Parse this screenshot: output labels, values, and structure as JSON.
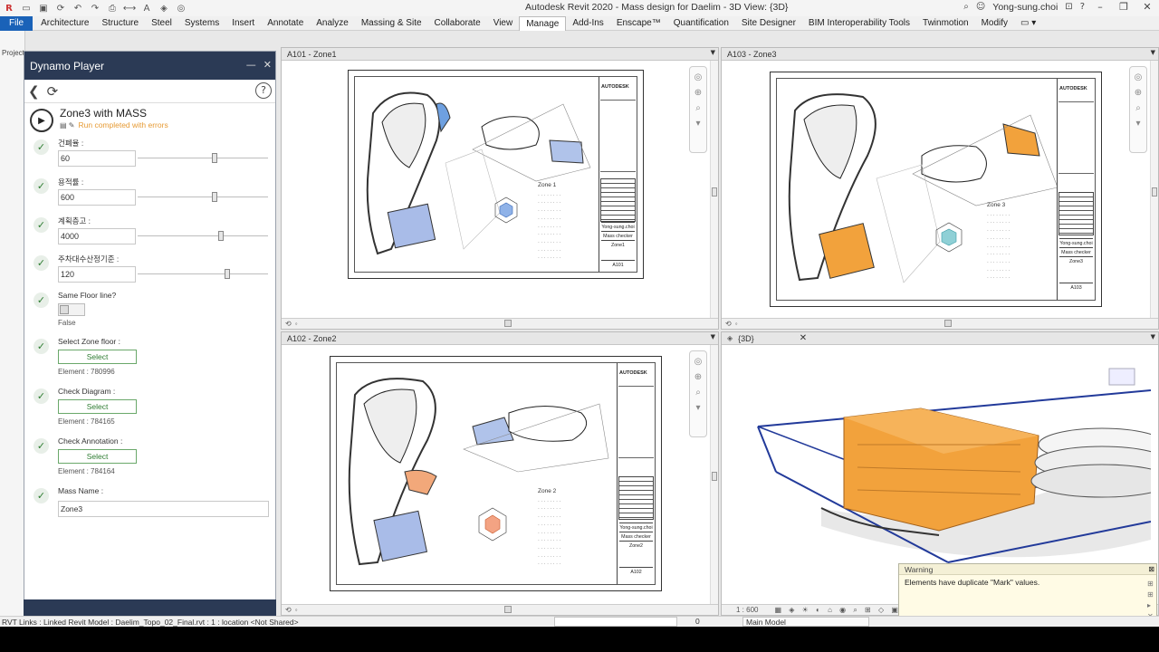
{
  "app": {
    "title": "Autodesk Revit 2020 - Mass design for Daelim - 3D View: {3D}",
    "user": "Yong-sung.choi"
  },
  "ribbon": {
    "tabs": [
      "File",
      "Architecture",
      "Structure",
      "Steel",
      "Systems",
      "Insert",
      "Annotate",
      "Analyze",
      "Massing & Site",
      "Collaborate",
      "View",
      "Manage",
      "Add-Ins",
      "Enscape™",
      "Quantification",
      "Site Designer",
      "BIM Interoperability Tools",
      "Twinmotion",
      "Modify"
    ],
    "active": "Manage"
  },
  "project_browser": {
    "label": "Project"
  },
  "dynamo": {
    "title": "Dynamo Player",
    "script_name": "Zone3 with MASS",
    "status": "Run completed with errors",
    "inputs": [
      {
        "label": "건폐율 :",
        "value": "60",
        "slider": 0.59
      },
      {
        "label": "용적률 :",
        "value": "600",
        "slider": 0.59
      },
      {
        "label": "계획층고 :",
        "value": "4000",
        "slider": 0.64
      },
      {
        "label": "주차대수산정기준 :",
        "value": "120",
        "slider": 0.69
      }
    ],
    "same_floor": {
      "label": "Same Floor line?",
      "value": "False"
    },
    "selects": [
      {
        "label": "Select Zone floor :",
        "button": "Select",
        "element": "Element : 780996"
      },
      {
        "label": "Check Diagram :",
        "button": "Select",
        "element": "Element : 784165"
      },
      {
        "label": "Check Annotation :",
        "button": "Select",
        "element": "Element : 784164"
      }
    ],
    "mass_name": {
      "label": "Mass Name :",
      "value": "Zone3"
    }
  },
  "views": {
    "a101": {
      "tab": "A101 - Zone1",
      "zone": "Zone 1",
      "sheet_no": "A101",
      "designer": "Yong-sung.choi",
      "checker": "Mass checker",
      "zone_label": "Zone1"
    },
    "a103": {
      "tab": "A103 - Zone3",
      "zone": "Zone 3",
      "sheet_no": "A103",
      "designer": "Yong-sung.choi",
      "checker": "Mass checker",
      "zone_label": "Zone3"
    },
    "a102": {
      "tab": "A102 - Zone2",
      "zone": "Zone 2",
      "sheet_no": "A102",
      "designer": "Yong-sung.choi",
      "checker": "Mass checker",
      "zone_label": "Zone2"
    },
    "v3d": {
      "tab": "{3D}",
      "scale": "1 : 600"
    }
  },
  "sheet_brand": "AUTODESK",
  "warning": {
    "title": "Warning",
    "message": "Elements have duplicate \"Mark\" values."
  },
  "status": {
    "left": "RVT Links : Linked Revit Model : Daelim_Topo_02_Final.rvt : 1 : location <Not Shared>",
    "zero": "0",
    "model": "Main Model"
  },
  "colors": {
    "dynamo_header": "#2b3a55",
    "accent_orange": "#f0a040",
    "mass_blue": "#9fb4e8",
    "error_status": "#e69a33",
    "file_tab": "#1a62b8"
  }
}
